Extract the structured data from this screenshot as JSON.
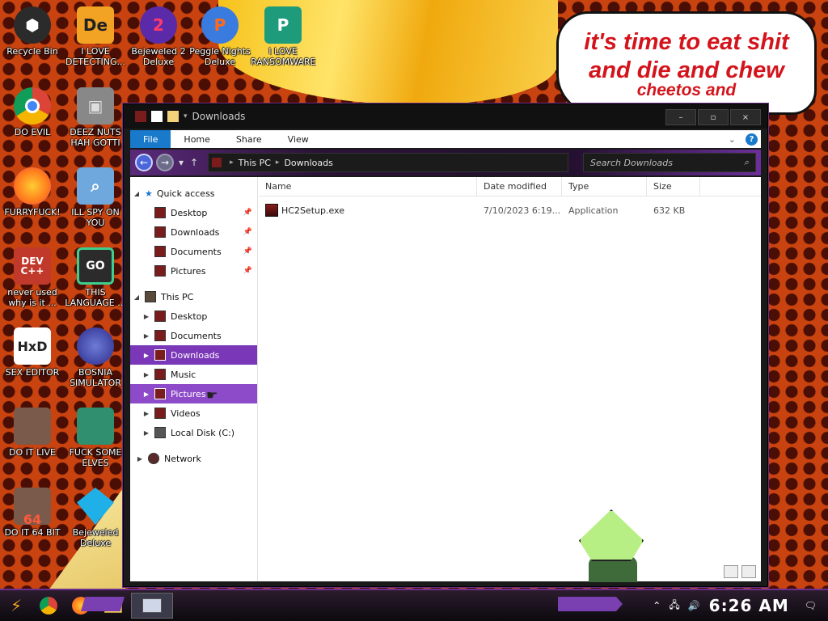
{
  "bubble": {
    "line1": "it's time to eat shit",
    "line2": "and die and chew",
    "line3": "cheetos and"
  },
  "desktop_icons": [
    {
      "label": "Recycle Bin",
      "color": "#2b2b2b"
    },
    {
      "label": "I LOVE DETECTING...",
      "color": "#f2a324"
    },
    {
      "label": "Bejeweled 2 Deluxe",
      "color": "#5a2aa8"
    },
    {
      "label": "Peggle Nights Deluxe",
      "color": "#3a7be0"
    },
    {
      "label": "I LOVE RANSOMWARE",
      "color": "#1e9b7a"
    },
    {
      "label": "DO EVIL",
      "color": "#4285f4"
    },
    {
      "label": "DEEZ NUTS HAH GOTTI",
      "color": "#888888"
    },
    {
      "label": "FURRYFUCK!",
      "color": "#ff7b1c"
    },
    {
      "label": "ILL SPY ON YOU",
      "color": "#6fa8dc"
    },
    {
      "label": "never used why is it ...",
      "color": "#c0392b"
    },
    {
      "label": "THIS LANGUAGE ...",
      "color": "#2b2b2b"
    },
    {
      "label": "SEX EDITOR",
      "color": "#ffffff"
    },
    {
      "label": "BOSNIA SIMULATOR",
      "color": "#3b3bb0"
    },
    {
      "label": "DO IT LIVE",
      "color": "#7a5a4a"
    },
    {
      "label": "FUCK SOME ELVES",
      "color": "#2f8f6f"
    },
    {
      "label": "DO IT 64 BIT",
      "color": "#7a5a4a"
    },
    {
      "label": "Bejeweled Deluxe",
      "color": "#1fb0e8"
    }
  ],
  "icon_glyphs": {
    "dexter": "De",
    "bejeweled2": "2",
    "peggle": "P",
    "ransomware": "P",
    "dev": "DEV C++",
    "go": "GO",
    "hxd": "HxD",
    "sixtyfour": "64"
  },
  "window": {
    "title": "Downloads",
    "caption": {
      "minimize": "–",
      "maximize": "▫",
      "close": "×"
    },
    "ribbon_tabs": [
      "File",
      "Home",
      "Share",
      "View"
    ],
    "ribbon_expand": "⌄",
    "help": "?",
    "address": {
      "segments": [
        "This PC",
        "Downloads"
      ]
    },
    "search_placeholder": "Search Downloads",
    "tree": {
      "quick_access": "Quick access",
      "quick_items": [
        "Desktop",
        "Downloads",
        "Documents",
        "Pictures"
      ],
      "this_pc": "This PC",
      "pc_items": [
        "Desktop",
        "Documents",
        "Downloads",
        "Music",
        "Pictures",
        "Videos",
        "Local Disk (C:)"
      ],
      "network": "Network"
    },
    "columns": [
      "Name",
      "Date modified",
      "Type",
      "Size"
    ],
    "files": [
      {
        "name": "HC2Setup.exe",
        "date": "7/10/2023 6:19...",
        "type": "Application",
        "size": "632 KB"
      }
    ]
  },
  "taskbar": {
    "clock": "6:26 AM"
  }
}
